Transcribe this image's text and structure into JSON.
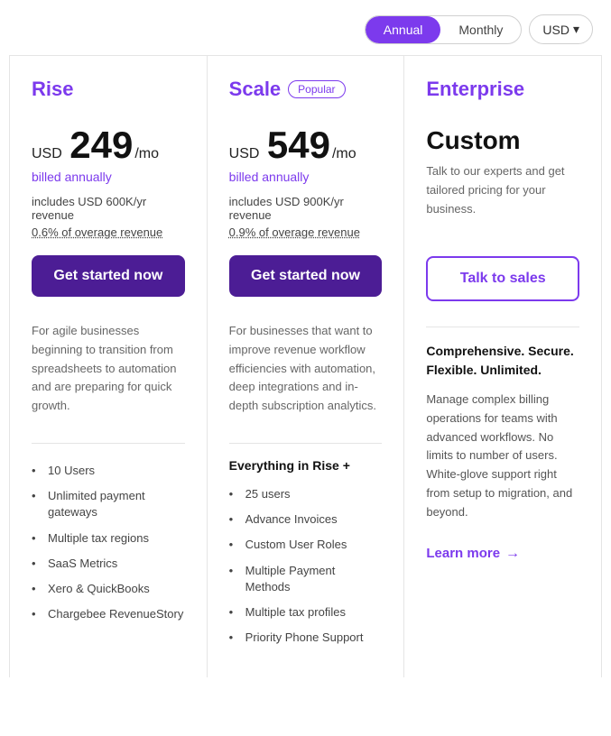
{
  "controls": {
    "annual_label": "Annual",
    "monthly_label": "Monthly",
    "currency_label": "USD",
    "chevron": "▾"
  },
  "plans": [
    {
      "id": "rise",
      "name": "Rise",
      "popular": false,
      "price_currency": "USD",
      "price_amount": "249",
      "price_per": "/mo",
      "billed_note": "billed annually",
      "includes": "includes USD 600K/yr revenue",
      "overage": "0.6% of overage revenue",
      "cta_label": "Get started now",
      "cta_type": "filled",
      "description": "For agile businesses beginning to transition from spreadsheets to automation and are preparing for quick growth.",
      "features_heading": "",
      "features": [
        "10 Users",
        "Unlimited payment gateways",
        "Multiple tax regions",
        "SaaS Metrics",
        "Xero & QuickBooks",
        "Chargebee RevenueStory"
      ]
    },
    {
      "id": "scale",
      "name": "Scale",
      "popular": true,
      "popular_label": "Popular",
      "price_currency": "USD",
      "price_amount": "549",
      "price_per": "/mo",
      "billed_note": "billed annually",
      "includes": "includes USD 900K/yr revenue",
      "overage": "0.9% of overage revenue",
      "cta_label": "Get started now",
      "cta_type": "filled",
      "description": "For businesses that want to improve revenue workflow efficiencies with automation, deep integrations and in-depth subscription analytics.",
      "features_heading": "Everything in Rise +",
      "features": [
        "25 users",
        "Advance Invoices",
        "Custom User Roles",
        "Multiple Payment Methods",
        "Multiple tax profiles",
        "Priority Phone Support"
      ]
    },
    {
      "id": "enterprise",
      "name": "Enterprise",
      "popular": false,
      "price_custom": "Custom",
      "enterprise_talk": "Talk to our experts and get tailored pricing for your business.",
      "cta_label": "Talk to sales",
      "cta_type": "outlined",
      "enterprise_tagline": "Comprehensive. Secure. Flexible. Unlimited.",
      "enterprise_detail": "Manage complex billing operations for teams with advanced workflows. No limits to number of users. White-glove support right from setup to migration, and beyond.",
      "learn_more_label": "Learn more",
      "features_heading": "",
      "features": []
    }
  ]
}
